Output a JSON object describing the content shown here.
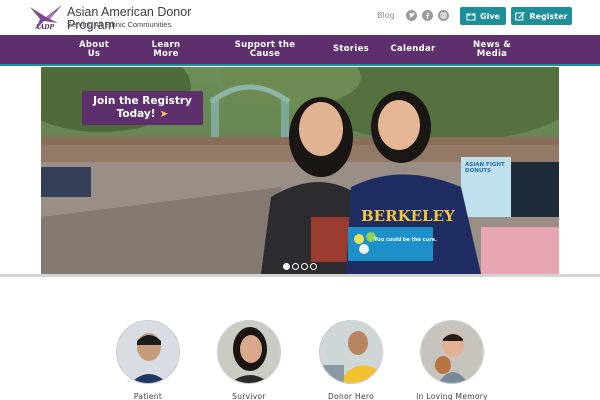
{
  "header": {
    "org_name_line1": "Asian American Donor",
    "org_name_line2": "Program",
    "tagline": "Serving All Ethnic Communities",
    "logo_abbr": "AADP",
    "blog_label": "Blog",
    "give_label": "Give",
    "register_label": "Register"
  },
  "nav": {
    "items": [
      {
        "line1": "About",
        "line2": "Us"
      },
      {
        "line1": "Learn",
        "line2": "More"
      },
      {
        "line1": "Support the",
        "line2": "Cause"
      },
      {
        "line1": "Stories",
        "line2": ""
      },
      {
        "line1": "Calendar",
        "line2": ""
      },
      {
        "line1": "News &",
        "line2": "Media"
      }
    ]
  },
  "hero": {
    "cta_line1": "Join the Registry",
    "cta_line2": "Today!",
    "cta_arrow": "➤",
    "shirt_text": "BERKELEY",
    "card_text": "You could be the cure.",
    "banner_text": "ASIAN FIGHT DONUTS",
    "slides": 4,
    "active_slide": 1
  },
  "stories": [
    {
      "label": "Patient"
    },
    {
      "label": "Survivor"
    },
    {
      "label": "Donor Hero"
    },
    {
      "label": "In Loving Memory"
    }
  ],
  "colors": {
    "purple": "#5d2f6d",
    "teal": "#1d8f9a"
  }
}
